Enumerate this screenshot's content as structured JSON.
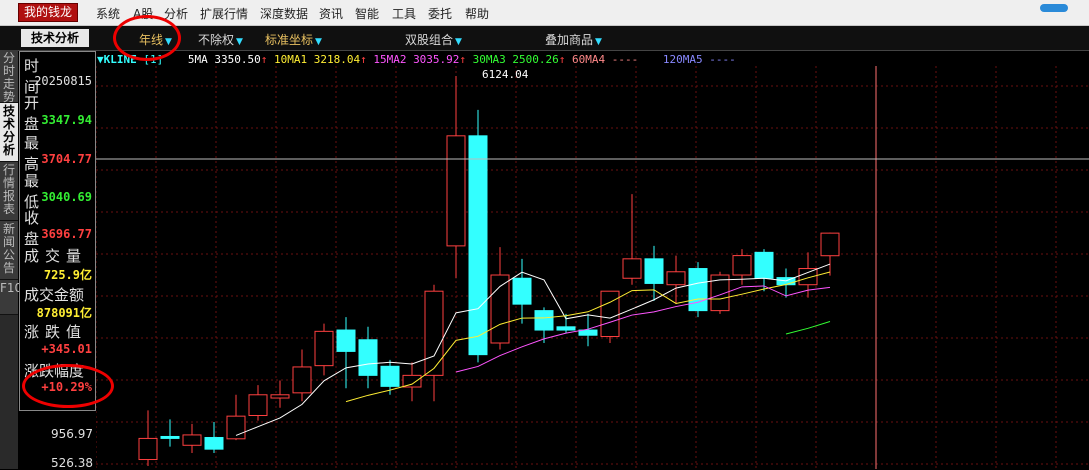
{
  "menubar": {
    "logo": "我的钱龙",
    "items": [
      "系统",
      "A股",
      "分析",
      "扩展行情",
      "深度数据",
      "资讯",
      "智能",
      "工具",
      "委托",
      "帮助"
    ]
  },
  "toolbar": {
    "active_tab": "技术分析",
    "period": "年线",
    "rights": "不除权",
    "coords": "标准坐标",
    "dual": "双股组合",
    "overlay": "叠加商品"
  },
  "sidetabs": [
    "分时走势",
    "技术分析",
    "行情报表",
    "新闻公告",
    "F10"
  ],
  "info": {
    "time_label": "时间",
    "time_value": "20250815",
    "open_label": "开盘",
    "open_value": "3347.94",
    "high_label": "最高",
    "high_value": "3704.77",
    "low_label": "最低",
    "low_value": "3040.69",
    "close_label": "收盘",
    "close_value": "3696.77",
    "volume_label": "成交量",
    "volume_value": "725.9亿",
    "amount_label": "成交金额",
    "amount_value": "878091亿",
    "change_label": "涨跌值",
    "change_value": "+345.01",
    "pct_label": "涨跌幅度",
    "pct_value": "+10.29%"
  },
  "legend": {
    "name": "▼KLINE",
    "bracket": "[1]",
    "ma5": "5MA 3350.50",
    "ma10": "10MA1 3218.04",
    "ma15": "15MA2 3035.92",
    "ma30": "30MA3 2500.26",
    "ma60": "60MA4 ----",
    "ma120": "120MA5 ----"
  },
  "peak_label": "6124.04",
  "axis_labels": [
    "956.97",
    "526.38"
  ],
  "colors": {
    "up": "#ff4040",
    "down": "#33ffff",
    "ma5": "#ffffff",
    "ma10": "#ffee33",
    "ma15": "#ff55ff",
    "ma30": "#33ff33"
  },
  "chart_data": {
    "type": "candlestick",
    "period": "yearly",
    "visible_axis_labels": [
      "6124.04",
      "956.97",
      "526.38"
    ],
    "candles": [
      {
        "open": 200,
        "close": 526,
        "high": 960,
        "low": 100
      },
      {
        "open": 556,
        "close": 526,
        "high": 820,
        "low": 400
      },
      {
        "open": 420,
        "close": 580,
        "high": 750,
        "low": 300
      },
      {
        "open": 540,
        "close": 360,
        "high": 780,
        "low": 300
      },
      {
        "open": 520,
        "close": 870,
        "high": 1200,
        "low": 500
      },
      {
        "open": 880,
        "close": 1200,
        "high": 1350,
        "low": 800
      },
      {
        "open": 1150,
        "close": 1200,
        "high": 1420,
        "low": 1000
      },
      {
        "open": 1230,
        "close": 1630,
        "high": 1900,
        "low": 1100
      },
      {
        "open": 1650,
        "close": 2180,
        "high": 2300,
        "low": 1500
      },
      {
        "open": 2200,
        "close": 1870,
        "high": 2400,
        "low": 1300
      },
      {
        "open": 2050,
        "close": 1500,
        "high": 2250,
        "low": 1300
      },
      {
        "open": 1640,
        "close": 1330,
        "high": 1740,
        "low": 1200
      },
      {
        "open": 1320,
        "close": 1500,
        "high": 1700,
        "low": 1100
      },
      {
        "open": 1500,
        "close": 2800,
        "high": 2900,
        "low": 1100
      },
      {
        "open": 3500,
        "close": 5200,
        "high": 6124,
        "low": 3000
      },
      {
        "open": 5200,
        "close": 1820,
        "high": 5600,
        "low": 1700
      },
      {
        "open": 2000,
        "close": 3050,
        "high": 3480,
        "low": 1900
      },
      {
        "open": 3000,
        "close": 2600,
        "high": 3300,
        "low": 2300
      },
      {
        "open": 2500,
        "close": 2200,
        "high": 2550,
        "low": 2000
      },
      {
        "open": 2250,
        "close": 2200,
        "high": 2450,
        "low": 2150
      },
      {
        "open": 2200,
        "close": 2120,
        "high": 2450,
        "low": 1950
      },
      {
        "open": 2100,
        "close": 2800,
        "high": 2800,
        "low": 2000
      },
      {
        "open": 3000,
        "close": 3300,
        "high": 4300,
        "low": 2900
      },
      {
        "open": 3300,
        "close": 2920,
        "high": 3500,
        "low": 2650
      },
      {
        "open": 2900,
        "close": 3100,
        "high": 3350,
        "low": 2600
      },
      {
        "open": 3150,
        "close": 2500,
        "high": 3250,
        "low": 2400
      },
      {
        "open": 2500,
        "close": 3050,
        "high": 3100,
        "low": 2450
      },
      {
        "open": 3050,
        "close": 3350,
        "high": 3450,
        "low": 2900
      },
      {
        "open": 3400,
        "close": 3000,
        "high": 3450,
        "low": 2800
      },
      {
        "open": 3010,
        "close": 2900,
        "high": 3150,
        "low": 2700
      },
      {
        "open": 2900,
        "close": 3150,
        "high": 3400,
        "low": 2700
      },
      {
        "open": 3348,
        "close": 3697,
        "high": 3705,
        "low": 3041
      }
    ]
  }
}
